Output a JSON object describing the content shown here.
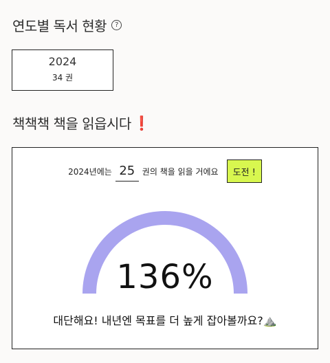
{
  "yearly": {
    "title": "연도별 독서 현황",
    "help_icon": "?",
    "cards": [
      {
        "year": "2024",
        "count": "34 권"
      }
    ]
  },
  "challenge": {
    "title": "책책책 책을 읽읍시다",
    "exclaim": "❗",
    "prefix": "2024년에는",
    "goal_value": "25",
    "suffix": "권의 책을 읽을 거에요",
    "button_label": "도전 !",
    "percent_text": "136%",
    "percent": 136,
    "message": "대단해요! 내년엔 목표를 더 높게 잡아볼까요?⛰️",
    "gauge_color": "#a9a4ef"
  }
}
